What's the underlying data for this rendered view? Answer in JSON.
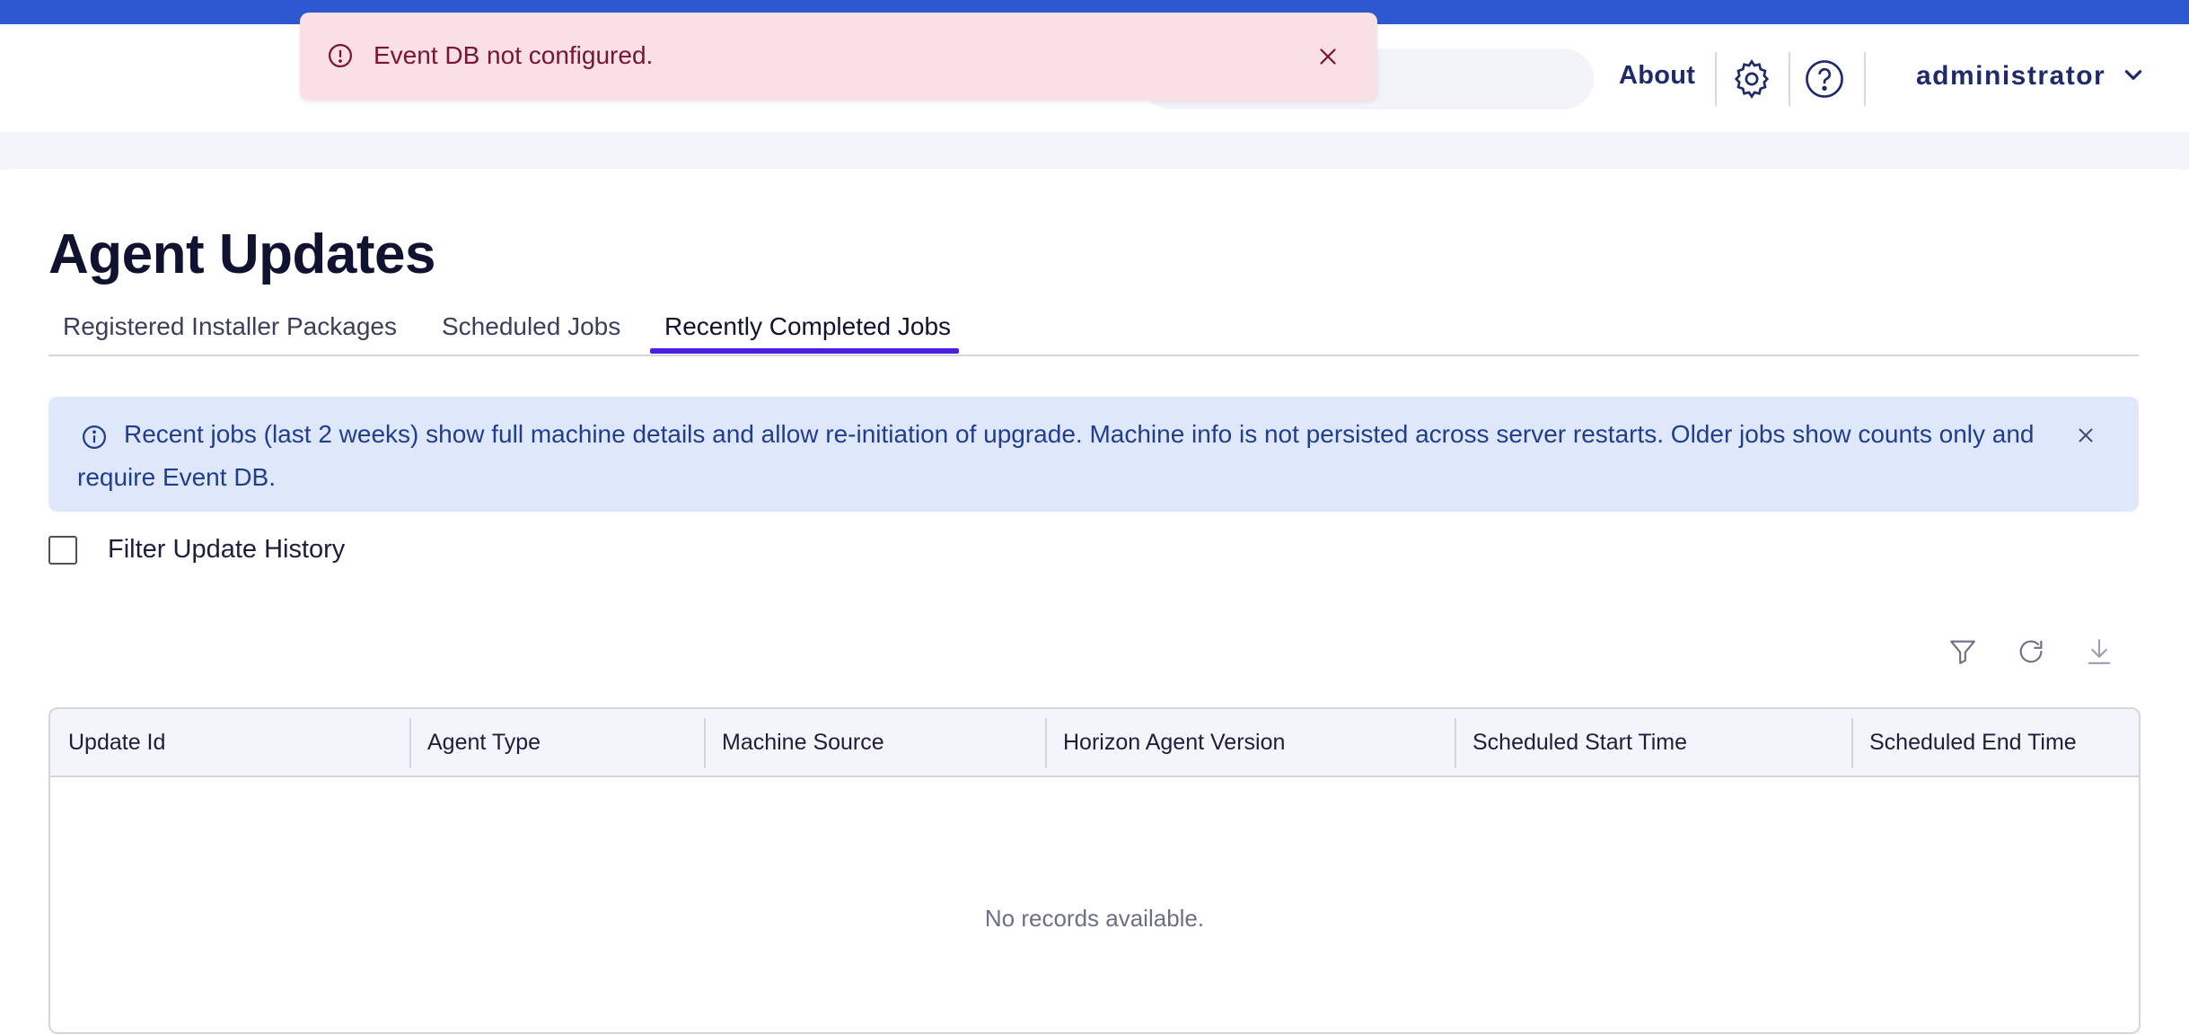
{
  "header": {
    "about_label": "About",
    "user_name": "administrator",
    "icons": [
      "gear-icon",
      "help-icon",
      "chevron-down-icon"
    ]
  },
  "toast": {
    "message": "Event DB not configured.",
    "icon": "alert-circle-icon",
    "close_icon": "close-icon"
  },
  "page": {
    "title": "Agent Updates"
  },
  "tabs": [
    {
      "label": "Registered Installer Packages",
      "active": false
    },
    {
      "label": "Scheduled Jobs",
      "active": false
    },
    {
      "label": "Recently Completed Jobs",
      "active": true
    }
  ],
  "info_banner": {
    "text": "Recent jobs (last 2 weeks) show full machine details and allow re-initiation of upgrade. Machine info is not persisted across server restarts. Older jobs show counts only and require Event DB.",
    "icon": "info-icon"
  },
  "filter": {
    "label": "Filter Update History",
    "checked": false
  },
  "grid_toolbar": {
    "icons": [
      "filter-icon",
      "refresh-icon",
      "download-icon"
    ]
  },
  "table": {
    "columns": [
      "Update Id",
      "Agent Type",
      "Machine Source",
      "Horizon Agent Version",
      "Scheduled Start Time",
      "Scheduled End Time"
    ],
    "rows": [],
    "empty_message": "No records available."
  },
  "colors": {
    "topbar": "#2d58cf",
    "accent_tab": "#4a1fe0",
    "toast_bg": "#f9e0e5",
    "toast_text": "#7a1335",
    "info_bg": "#dfe8fb",
    "info_text": "#213d8f"
  }
}
